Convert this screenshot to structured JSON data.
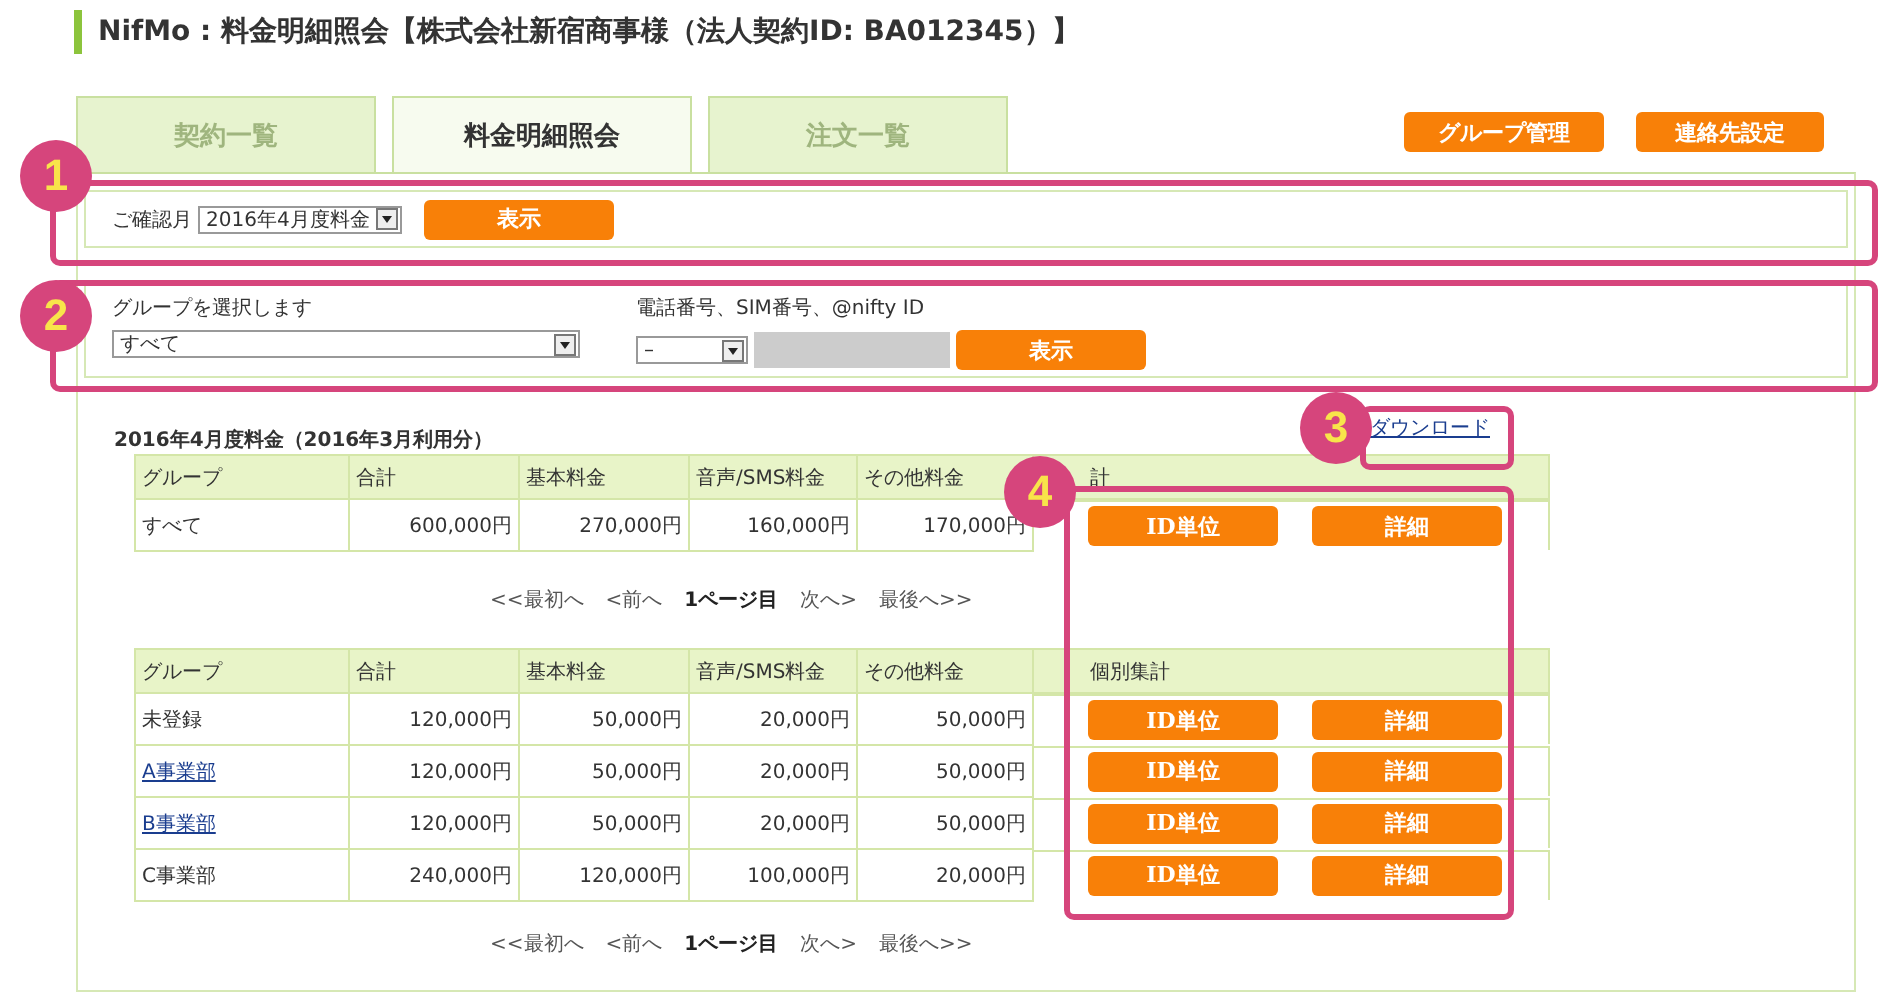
{
  "header": {
    "title": "NifMo : 料金明細照会【株式会社新宿商事様（法人契約ID: BA012345）】"
  },
  "tabs": [
    {
      "label": "契約一覧",
      "selected": false
    },
    {
      "label": "料金明細照会",
      "selected": true
    },
    {
      "label": "注文一覧",
      "selected": false
    }
  ],
  "top_buttons": [
    "グループ管理",
    "連絡先設定"
  ],
  "month_filter": {
    "label": "ご確認月",
    "value": "2016年4月度料金",
    "button": "表示"
  },
  "group_filter": {
    "group_label": "グループを選択します",
    "group_value": "すべて",
    "id_label": "電話番号、SIM番号、@nifty ID",
    "id_type_value": "–",
    "button": "表示"
  },
  "summary": {
    "title": "2016年4月度料金（2016年3月利用分）",
    "download": "ダウンロード",
    "columns": [
      "グループ",
      "合計",
      "基本料金",
      "音声/SMS料金",
      "その他料金",
      "計"
    ],
    "rows": [
      {
        "group": "すべて",
        "link": false,
        "total": "600,000円",
        "basic": "270,000円",
        "voice": "160,000円",
        "other": "170,000円",
        "buttons": [
          "ID単位",
          "詳細"
        ]
      }
    ]
  },
  "pager_top": [
    {
      "label": "<<最初へ",
      "selected": false
    },
    {
      "label": "<前へ",
      "selected": false
    },
    {
      "label": "1ページ目",
      "selected": true
    },
    {
      "label": "次へ>",
      "selected": false
    },
    {
      "label": "最後へ>>",
      "selected": false
    }
  ],
  "groups": {
    "columns": [
      "グループ",
      "合計",
      "基本料金",
      "音声/SMS料金",
      "その他料金",
      "個別集計"
    ],
    "rows": [
      {
        "group": "未登録",
        "link": false,
        "total": "120,000円",
        "basic": "50,000円",
        "voice": "20,000円",
        "other": "50,000円",
        "buttons": [
          "ID単位",
          "詳細"
        ]
      },
      {
        "group": "A事業部",
        "link": true,
        "total": "120,000円",
        "basic": "50,000円",
        "voice": "20,000円",
        "other": "50,000円",
        "buttons": [
          "ID単位",
          "詳細"
        ]
      },
      {
        "group": "B事業部",
        "link": true,
        "total": "120,000円",
        "basic": "50,000円",
        "voice": "20,000円",
        "other": "50,000円",
        "buttons": [
          "ID単位",
          "詳細"
        ]
      },
      {
        "group": "C事業部",
        "link": false,
        "total": "240,000円",
        "basic": "120,000円",
        "voice": "100,000円",
        "other": "20,000円",
        "buttons": [
          "ID単位",
          "詳細"
        ]
      }
    ]
  },
  "pager_bottom": [
    {
      "label": "<<最初へ",
      "selected": false
    },
    {
      "label": "<前へ",
      "selected": false
    },
    {
      "label": "1ページ目",
      "selected": true
    },
    {
      "label": "次へ>",
      "selected": false
    },
    {
      "label": "最後へ>>",
      "selected": false
    }
  ],
  "callouts": [
    {
      "number": "1"
    },
    {
      "number": "2"
    },
    {
      "number": "3"
    },
    {
      "number": "4"
    }
  ]
}
